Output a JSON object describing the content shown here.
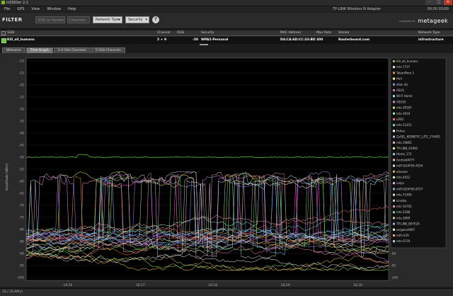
{
  "window": {
    "title": "inSSIDer 2.1",
    "min": "–",
    "max": "□",
    "close": "✕"
  },
  "menu": {
    "items": [
      "File",
      "GPS",
      "View",
      "Window",
      "Help"
    ],
    "adapter": "TP-LINK Wireless N Adapter",
    "clock": "00:00 03/00"
  },
  "filter": {
    "label": "FILTER",
    "ssid_placeholder": "SSID or Vendor",
    "channels_placeholder": "Channels",
    "network_type": "Network Type",
    "security": "Security",
    "help": "?"
  },
  "brand": {
    "powered": "POWERED BY",
    "name": "metageek"
  },
  "table": {
    "headers": [
      "SSID",
      "Channel",
      "RSSI",
      "Security",
      "MAC Address",
      "Max Rate",
      "Vendor",
      "Network Type"
    ],
    "row": {
      "ssid": "Kill_all_humans",
      "channel": "5 + 9",
      "rssi": "-50",
      "security": "WPA2-Personal",
      "mac": "D4:CA:6D:CC:33:BD",
      "max_rate": "300",
      "vendor": "Routerboard.com",
      "network_type": "Infrastructure"
    }
  },
  "tabs": [
    "Welcome",
    "Time Graph",
    "2.4 GHz Channels",
    "5 GHz Channels"
  ],
  "active_tab": "Time Graph",
  "graph": {
    "ylabel": "Amplitude [dBm]",
    "y_ticks": [
      "-10",
      "-15",
      "-20",
      "-25",
      "-30",
      "-35",
      "-40",
      "-45",
      "-50",
      "-55",
      "-60",
      "-65",
      "-70",
      "-75",
      "-80",
      "-85",
      "-90",
      "-95",
      "-100"
    ],
    "x_ticks": [
      "18:26",
      "18:27",
      "18:28",
      "18:29",
      "18:30"
    ],
    "legend": [
      {
        "name": "Kill_all_humans",
        "color": "#6bd64a"
      },
      {
        "name": "mts-7727",
        "color": "#e8e8e8"
      },
      {
        "name": "TabacMoro 2",
        "color": "#ff8c2a"
      },
      {
        "name": "Hall",
        "color": "#f2f26a"
      },
      {
        "name": "dlink 44",
        "color": "#5aa0ff"
      },
      {
        "name": "ASUS",
        "color": "#ff5ad2"
      },
      {
        "name": "Wi-Fi Home",
        "color": "#8ae8ff"
      },
      {
        "name": "ASUS0",
        "color": "#c28aff"
      },
      {
        "name": "mts-39187",
        "color": "#ffd24a"
      },
      {
        "name": "mts-3919",
        "color": "#9af26a"
      },
      {
        "name": "LIRIO",
        "color": "#ff6a6a"
      },
      {
        "name": "mts-11451",
        "color": "#6ae8c8"
      },
      {
        "name": "Polina",
        "color": "#ffffff"
      },
      {
        "name": "ZyXEL_KEENETIC_LITE_174405",
        "color": "#b0b0ff"
      },
      {
        "name": "mts-19805",
        "color": "#ffb0d8"
      },
      {
        "name": "TP-LINK_A1992",
        "color": "#d0ff8a"
      },
      {
        "name": "Home_173",
        "color": "#8ad0ff"
      },
      {
        "name": "AndroidAP77",
        "color": "#ffa8a8"
      },
      {
        "name": "mtFi-D2AF6S-4554",
        "color": "#e0e0e0"
      },
      {
        "name": "alexana",
        "color": "#ff9a3a"
      },
      {
        "name": "mts-4552",
        "color": "#a8ffd0"
      },
      {
        "name": "valya",
        "color": "#f0a0ff"
      },
      {
        "name": "mtFi-D2AF6S-8727",
        "color": "#7aa8ff"
      },
      {
        "name": "mts-71490",
        "color": "#ffe08a"
      },
      {
        "name": "kirsdka",
        "color": "#c8c8c8"
      },
      {
        "name": "mts-10705",
        "color": "#ff7acc"
      },
      {
        "name": "mts-2288",
        "color": "#70e070"
      },
      {
        "name": "mts-3969",
        "color": "#e8c070"
      },
      {
        "name": "TP-LINK_B07E2A",
        "color": "#90b0ff"
      },
      {
        "name": "sergeev0997",
        "color": "#ffffff"
      },
      {
        "name": "mtFi-429",
        "color": "#ffa070"
      },
      {
        "name": "mts-0729",
        "color": "#a0e0ff"
      }
    ]
  },
  "status": {
    "text": "33 / 33 AP(s)"
  }
}
